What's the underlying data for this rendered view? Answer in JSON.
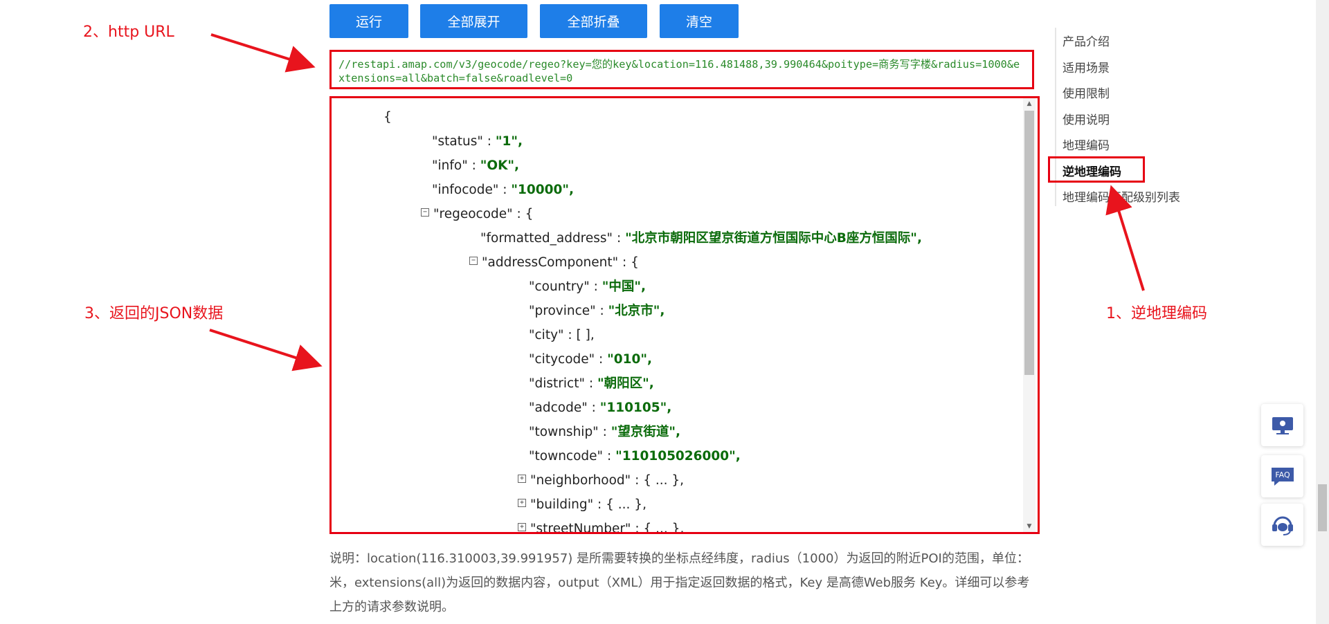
{
  "toolbar": {
    "run_label": "运行",
    "expand_all_label": "全部展开",
    "collapse_all_label": "全部折叠",
    "clear_label": "清空"
  },
  "request": {
    "url": "//restapi.amap.com/v3/geocode/regeo?key=您的key&location=116.481488,39.990464&poitype=商务写字楼&radius=1000&extensions=all&batch=false&roadlevel=0"
  },
  "json_lines": [
    {
      "text": "{",
      "indent": 0
    },
    {
      "key": "\"status\"",
      "value": "\"1\",",
      "indent": 1
    },
    {
      "key": "\"info\"",
      "value": "\"OK\",",
      "indent": 1
    },
    {
      "key": "\"infocode\"",
      "value": "\"10000\",",
      "indent": 1
    },
    {
      "key": "\"regeocode\"",
      "open": "{",
      "indent": 1,
      "toggle": "-"
    },
    {
      "key": "\"formatted_address\"",
      "value": "\"北京市朝阳区望京街道方恒国际中心B座方恒国际\",",
      "indent": 2
    },
    {
      "key": "\"addressComponent\"",
      "open": "{",
      "indent": 2,
      "toggle": "-"
    },
    {
      "key": "\"country\"",
      "value": "\"中国\",",
      "indent": 3
    },
    {
      "key": "\"province\"",
      "value": "\"北京市\",",
      "indent": 3
    },
    {
      "key": "\"city\"",
      "plain": "[ ],",
      "indent": 3
    },
    {
      "key": "\"citycode\"",
      "value": "\"010\",",
      "indent": 3
    },
    {
      "key": "\"district\"",
      "value": "\"朝阳区\",",
      "indent": 3
    },
    {
      "key": "\"adcode\"",
      "value": "\"110105\",",
      "indent": 3
    },
    {
      "key": "\"township\"",
      "value": "\"望京街道\",",
      "indent": 3
    },
    {
      "key": "\"towncode\"",
      "value": "\"110105026000\",",
      "indent": 3
    },
    {
      "key": "\"neighborhood\"",
      "plain": "{ ... },",
      "indent": 3,
      "toggle": "+"
    },
    {
      "key": "\"building\"",
      "plain": "{ ... },",
      "indent": 3,
      "toggle": "+"
    },
    {
      "key": "\"streetNumber\"",
      "plain": "{ ... },",
      "indent": 3,
      "toggle": "+"
    }
  ],
  "description": "说明：location(116.310003,39.991957) 是所需要转换的坐标点经纬度，radius（1000）为返回的附近POI的范围，单位：米，extensions(all)为返回的数据内容，output（XML）用于指定返回数据的格式，Key 是高德Web服务 Key。详细可以参考上方的请求参数说明。",
  "side_nav": [
    {
      "label": "产品介绍",
      "active": false
    },
    {
      "label": "适用场景",
      "active": false
    },
    {
      "label": "使用限制",
      "active": false
    },
    {
      "label": "使用说明",
      "active": false
    },
    {
      "label": "地理编码",
      "active": false
    },
    {
      "label": "逆地理编码",
      "active": true
    },
    {
      "label": "地理编码匹配级别列表",
      "active": false
    }
  ],
  "annotations": {
    "url_note": "2、http URL",
    "json_note": "3、返回的JSON数据",
    "nav_note": "1、逆地理编码"
  },
  "widgets": [
    {
      "icon": "monitor-icon"
    },
    {
      "icon": "faq-icon",
      "label": "FAQ"
    },
    {
      "icon": "support-headset-icon"
    }
  ],
  "colors": {
    "button": "#1e7ee8",
    "annotation": "#e8141d",
    "json_value": "#0b6b0b",
    "url_text": "#2a8a2a"
  }
}
